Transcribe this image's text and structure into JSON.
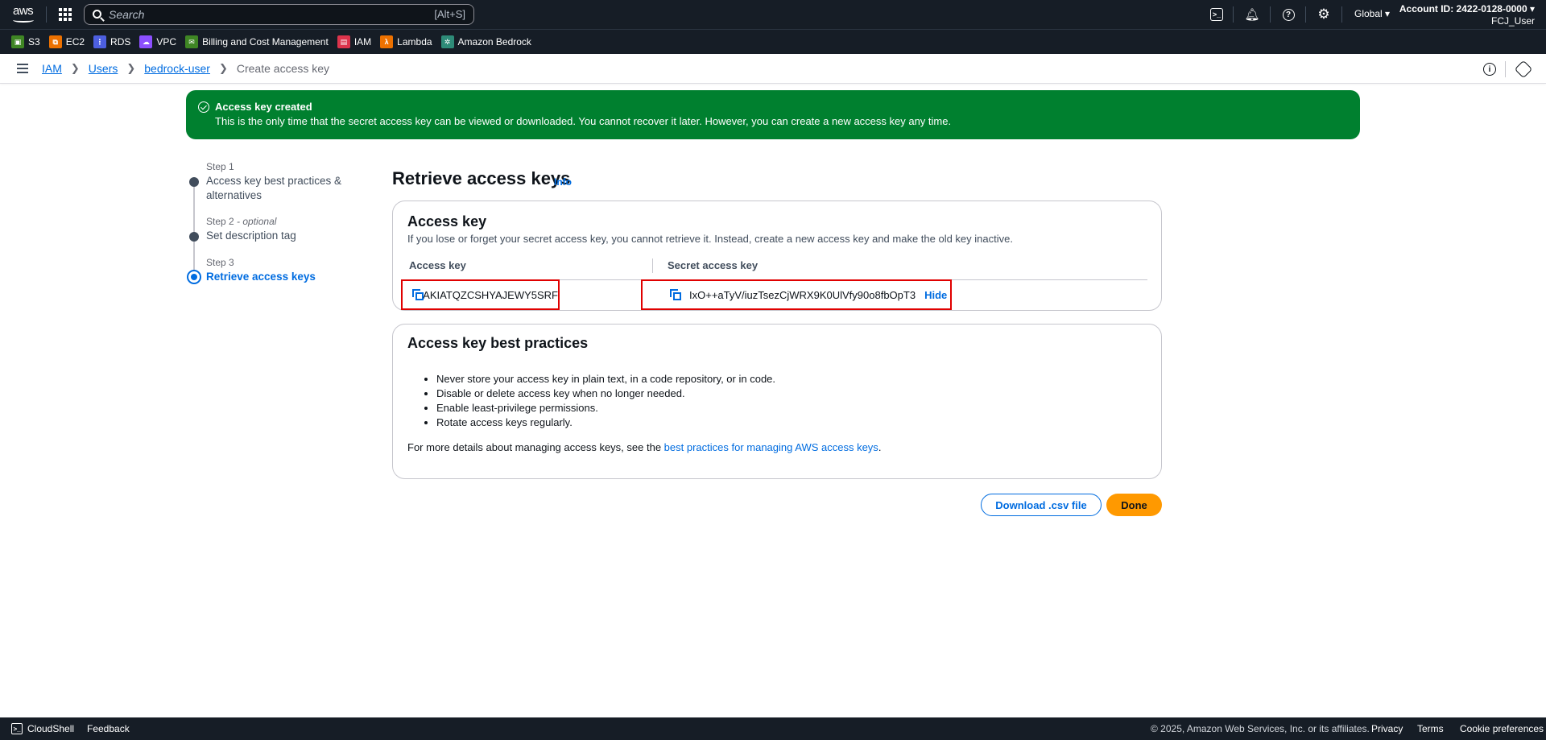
{
  "topnav": {
    "logo": "aws",
    "search_placeholder": "Search",
    "search_shortcut": "[Alt+S]",
    "icons": [
      "cloudshell-icon",
      "bell-icon",
      "help-icon",
      "gear-icon"
    ],
    "region": "Global ▾",
    "account_id": "Account ID: 2422-0128-0000 ▾",
    "user": "FCJ_User"
  },
  "favorites": [
    {
      "label": "S3",
      "color": "#3f8624",
      "glyph": "▣"
    },
    {
      "label": "EC2",
      "color": "#ed7100",
      "glyph": "⧉"
    },
    {
      "label": "RDS",
      "color": "#4d5fe0",
      "glyph": "⋮"
    },
    {
      "label": "VPC",
      "color": "#8c4fff",
      "glyph": "☁"
    },
    {
      "label": "Billing and Cost Management",
      "color": "#3f8624",
      "glyph": "✉"
    },
    {
      "label": "IAM",
      "color": "#dd344c",
      "glyph": "▤"
    },
    {
      "label": "Lambda",
      "color": "#ed7100",
      "glyph": "λ"
    },
    {
      "label": "Amazon Bedrock",
      "color": "#2e8b78",
      "glyph": "✲"
    }
  ],
  "breadcrumb": {
    "items": [
      "IAM",
      "Users",
      "bedrock-user"
    ],
    "current": "Create access key"
  },
  "flash": {
    "title": "Access key created",
    "message": "This is the only time that the secret access key can be viewed or downloaded. You cannot recover it later. However, you can create a new access key any time."
  },
  "steps": [
    {
      "label": "Step 1",
      "optional": "",
      "title": "Access key best practices & alternatives",
      "state": "complete"
    },
    {
      "label": "Step 2",
      "optional": " - optional",
      "title": "Set description tag",
      "state": "complete"
    },
    {
      "label": "Step 3",
      "optional": "",
      "title": "Retrieve access keys",
      "state": "active"
    }
  ],
  "page": {
    "title": "Retrieve access keys",
    "info": "Info"
  },
  "access_key_panel": {
    "title": "Access key",
    "description": "If you lose or forget your secret access key, you cannot retrieve it. Instead, create a new access key and make the old key inactive.",
    "col_access_key": "Access key",
    "col_secret_key": "Secret access key",
    "access_key_value": "AKIATQZCSHYAJEWY5SRF",
    "secret_key_value": "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",
    "hide_label": "Hide"
  },
  "best_practices": {
    "title": "Access key best practices",
    "items": [
      "Never store your access key in plain text, in a code repository, or in code.",
      "Disable or delete access key when no longer needed.",
      "Enable least-privilege permissions.",
      "Rotate access keys regularly."
    ],
    "more_prefix": "For more details about managing access keys, see the ",
    "more_link": "best practices for managing AWS access keys",
    "more_suffix": "."
  },
  "actions": {
    "download": "Download .csv file",
    "done": "Done"
  },
  "footer": {
    "cloudshell": "CloudShell",
    "feedback": "Feedback",
    "copyright": "© 2025, Amazon Web Services, Inc. or its affiliates.",
    "privacy": "Privacy",
    "terms": "Terms",
    "cookies": "Cookie preferences"
  }
}
